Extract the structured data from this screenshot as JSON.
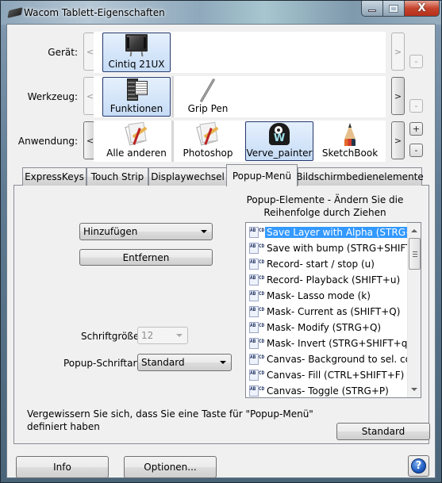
{
  "window": {
    "title": "Wacom Tablett-Eigenschaften",
    "controls": {
      "minimize": "–",
      "maximize": "□",
      "close": "X"
    }
  },
  "selectors": {
    "device": {
      "label": "Gerät:",
      "items": [
        {
          "label": "Cintiq 21UX",
          "icon": "tablet-monitor-icon",
          "selected": true
        }
      ],
      "prev": "<",
      "next": ">",
      "remove": "-"
    },
    "tool": {
      "label": "Werkzeug:",
      "items": [
        {
          "label": "Funktionen",
          "icon": "functions-icon",
          "selected": true
        },
        {
          "label": "Grip Pen",
          "icon": "pen-icon",
          "selected": false
        }
      ],
      "prev": "<",
      "next": ">",
      "remove": "-"
    },
    "application": {
      "label": "Anwendung:",
      "items": [
        {
          "label": "Alle anderen",
          "icon": "generic-app-icon",
          "selected": false
        },
        {
          "label": "Photoshop",
          "icon": "generic-app-icon",
          "selected": false
        },
        {
          "label": "Verve_painter",
          "icon": "verve-icon",
          "selected": true
        },
        {
          "label": "SketchBook",
          "icon": "pencil-icon",
          "selected": false
        }
      ],
      "prev": "<",
      "next": ">",
      "add": "+",
      "remove": "-"
    }
  },
  "tabs": [
    {
      "label": "ExpressKeys",
      "active": false
    },
    {
      "label": "Touch Strip",
      "active": false
    },
    {
      "label": "Displaywechsel",
      "active": false
    },
    {
      "label": "Popup-Menü",
      "active": true
    },
    {
      "label": "Bildschirmbedienelemente",
      "active": false
    }
  ],
  "popup_tab": {
    "list_heading": "Popup-Elemente - Ändern Sie die Reihenfolge durch Ziehen",
    "add_dropdown": {
      "value": "Hinzufügen"
    },
    "remove_button": "Entfernen",
    "font_size": {
      "label": "Schriftgröße:",
      "value": "12",
      "disabled": true
    },
    "font": {
      "label": "Popup-Schriftart:",
      "value": "Standard"
    },
    "items": [
      {
        "label": "Save Layer with Alpha (STRG+S)",
        "selected": true
      },
      {
        "label": "Save with bump (STRG+SHIFT+S)",
        "selected": false
      },
      {
        "label": "Record- start / stop (u)",
        "selected": false
      },
      {
        "label": "Record- Playback  (SHIFT+u)",
        "selected": false
      },
      {
        "label": "Mask- Lasso mode (k)",
        "selected": false
      },
      {
        "label": "Mask- Current as (SHIFT+Q)",
        "selected": false
      },
      {
        "label": "Mask- Modify (STRG+Q)",
        "selected": false
      },
      {
        "label": "Mask- Invert  (STRG+SHIFT+q)",
        "selected": false
      },
      {
        "label": "Canvas- Background to sel. color",
        "selected": false
      },
      {
        "label": "Canvas- Fill (CTRL+SHIFT+F)",
        "selected": false
      },
      {
        "label": "Canvas- Toggle  (STRG+P)",
        "selected": false
      }
    ],
    "item_icon": "keystroke-abcd-icon",
    "icon_text": "AB CD",
    "hint": "Vergewissern Sie sich, dass Sie eine Taste für \"Popup-Menü\" definiert haben",
    "default_button": "Standard"
  },
  "footer": {
    "info_button": "Info",
    "options_button": "Optionen...",
    "help_glyph": "?"
  },
  "colors": {
    "selection": "#3399ff",
    "tile_selected": "#c6dcf6",
    "close_button": "#c5432c"
  }
}
